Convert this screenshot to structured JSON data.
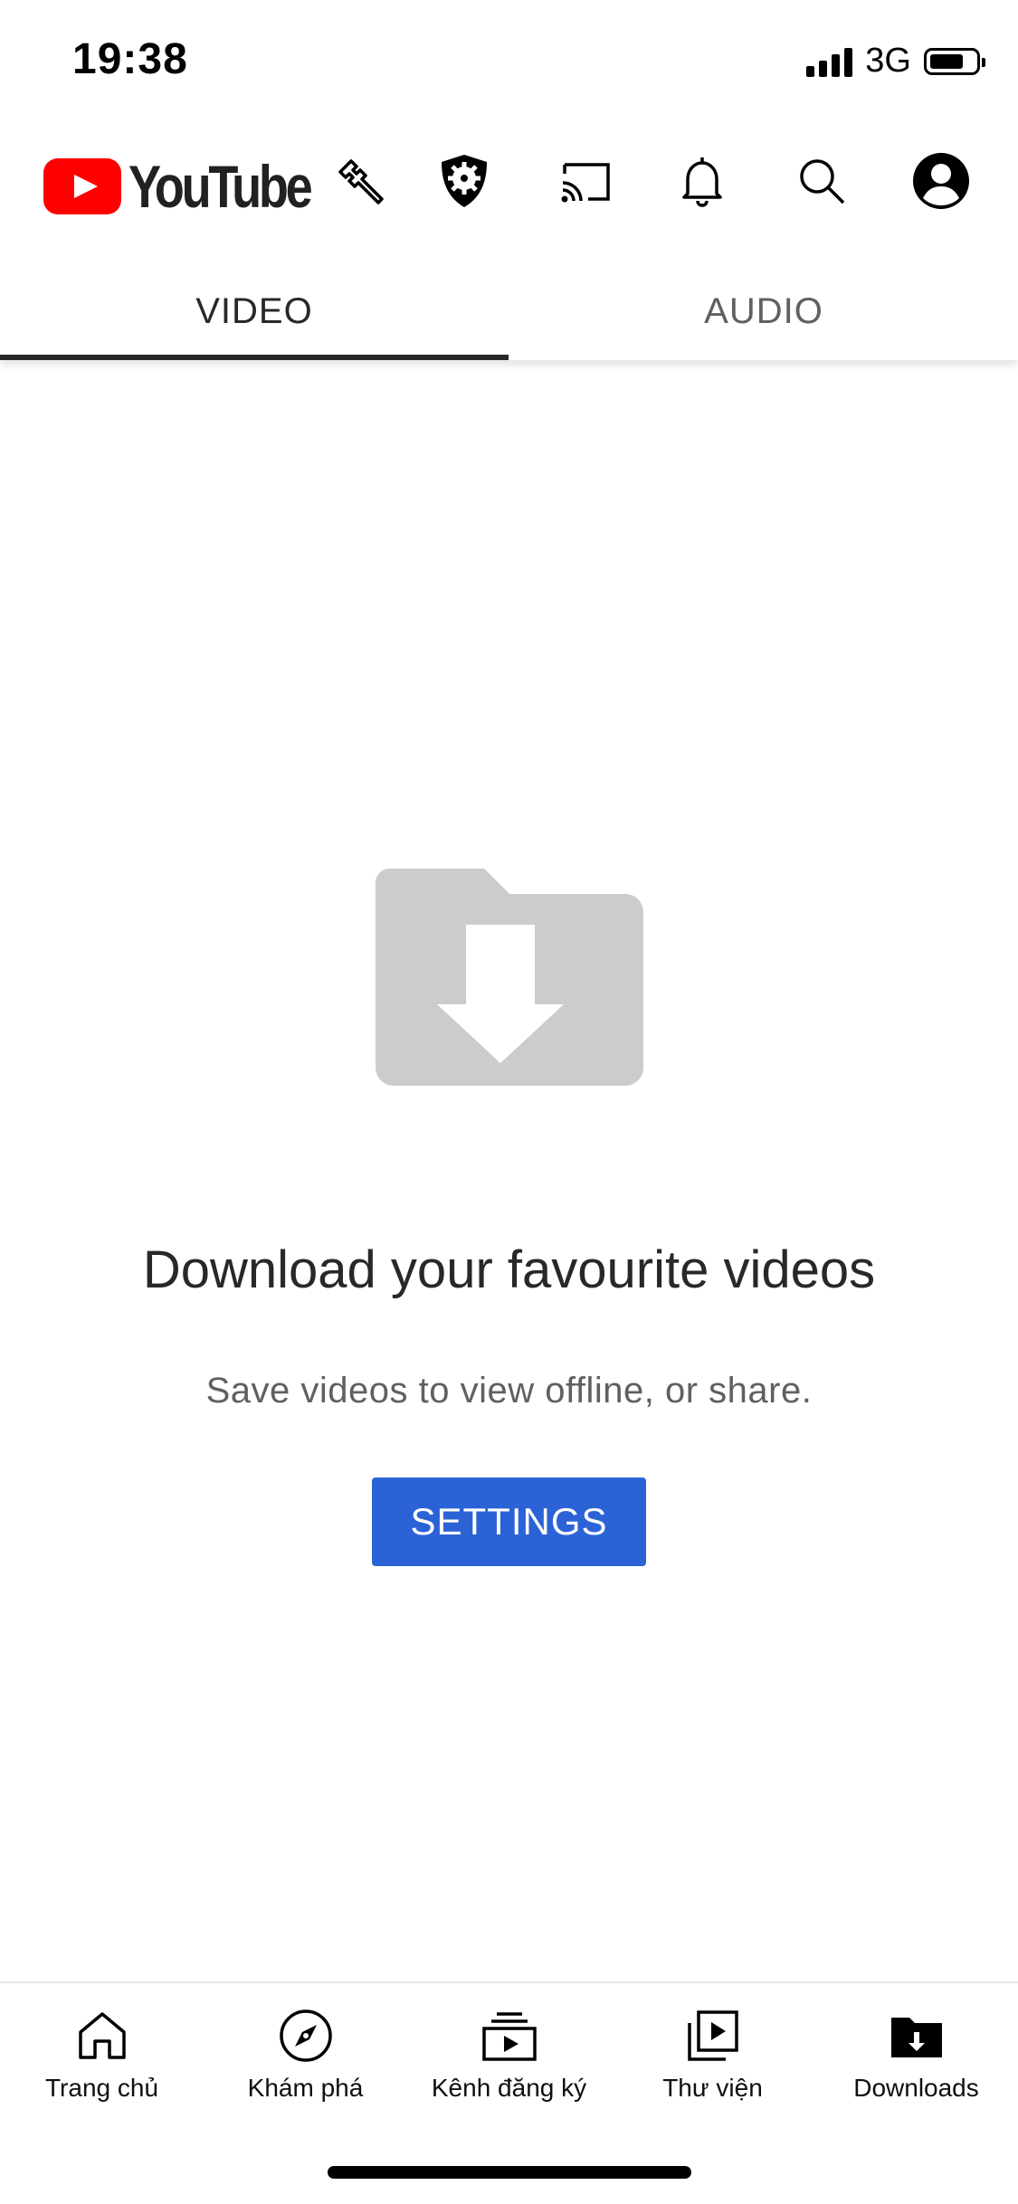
{
  "status_bar": {
    "time": "19:38",
    "network": "3G"
  },
  "header": {
    "logo_text": "YouTube",
    "icons": [
      "wrench-icon",
      "gear-shield-icon",
      "cast-icon",
      "bell-icon",
      "search-icon",
      "account-icon"
    ]
  },
  "tabs": [
    {
      "label": "VIDEO",
      "active": true
    },
    {
      "label": "AUDIO",
      "active": false
    }
  ],
  "empty_state": {
    "icon": "download-folder-icon",
    "title": "Download your favourite videos",
    "subtitle": "Save videos to view offline, or share.",
    "button_label": "SETTINGS"
  },
  "bottom_nav": {
    "items": [
      {
        "label": "Trang chủ",
        "icon": "home-icon"
      },
      {
        "label": "Khám phá",
        "icon": "explore-compass-icon"
      },
      {
        "label": "Kênh đăng ký",
        "icon": "subscriptions-icon"
      },
      {
        "label": "Thư viện",
        "icon": "library-icon"
      },
      {
        "label": "Downloads",
        "icon": "downloads-icon"
      }
    ]
  },
  "colors": {
    "brand_red": "#ff0000",
    "button_blue": "#2b63d6",
    "art_gray": "#cccccc",
    "text_dark": "#282828",
    "text_secondary": "#606060"
  }
}
